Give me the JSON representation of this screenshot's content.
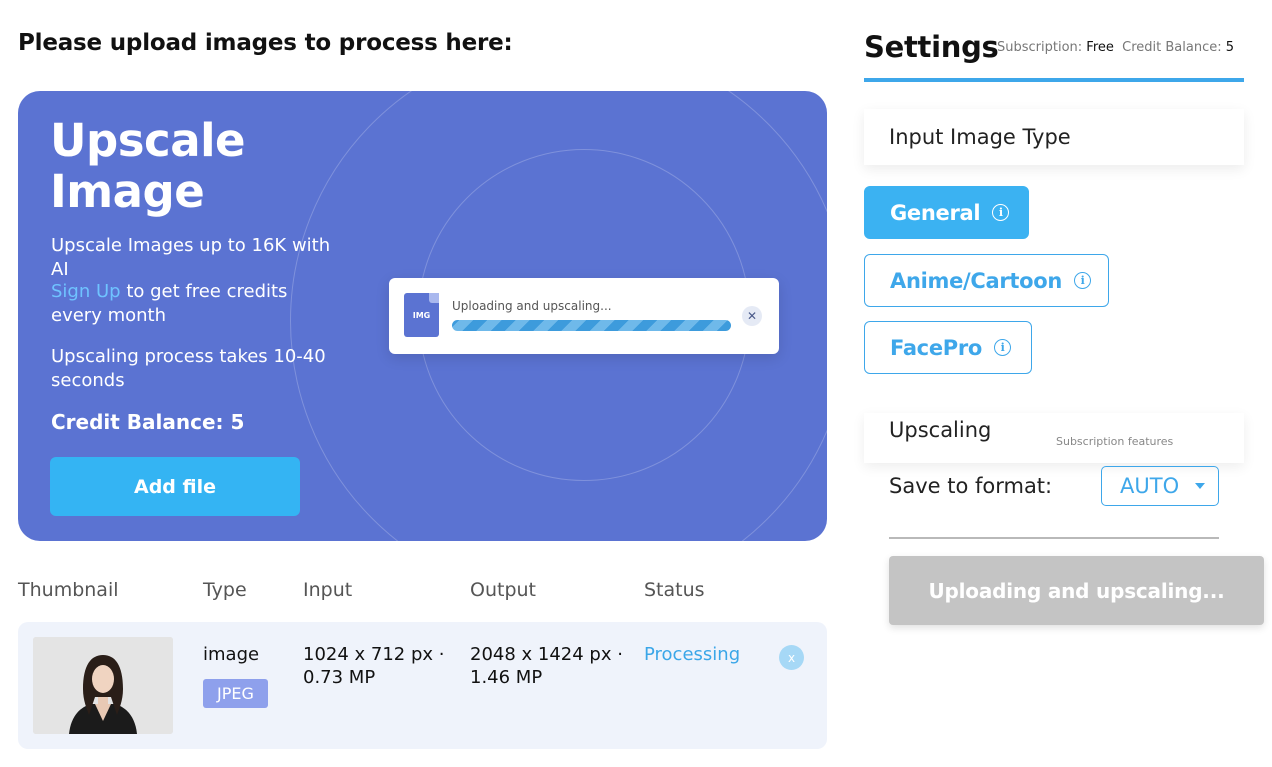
{
  "page": {
    "heading": "Please upload images to process here:"
  },
  "hero": {
    "title": "Upscale Image",
    "line1": "Upscale Images up to 16K with AI",
    "signup_link": "Sign Up",
    "signup_rest": " to get free credits every month",
    "line3": "Upscaling process takes 10-40 seconds",
    "credit_balance": "Credit Balance: 5",
    "add_file": "Add file",
    "upload_card": {
      "file_icon_label": "IMG",
      "status": "Uploading and upscaling...",
      "close": "✕"
    }
  },
  "table": {
    "headers": [
      "Thumbnail",
      "Type",
      "Input",
      "Output",
      "Status"
    ],
    "rows": [
      {
        "type": "image",
        "format": "JPEG",
        "input": "1024 x 712 px · 0.73 MP",
        "output": "2048 x 1424 px · 1.46 MP",
        "status": "Processing",
        "remove": "x"
      }
    ]
  },
  "settings": {
    "title": "Settings",
    "subscription_label": "Subscription:",
    "subscription_value": "Free",
    "credit_label": "Credit Balance:",
    "credit_value": "5",
    "input_type_title": "Input Image Type",
    "types": [
      {
        "label": "General",
        "active": true
      },
      {
        "label": "Anime/Cartoon",
        "active": false
      },
      {
        "label": "FacePro",
        "active": false
      }
    ],
    "upscaling_label": "Upscaling",
    "subscription_features": "Subscription features",
    "save_format_label": "Save to format:",
    "format_value": "AUTO",
    "process_button": "Uploading and upscaling..."
  },
  "colors": {
    "hero_bg": "#5b73d2",
    "accent": "#3ea7ea",
    "add_button": "#34b4f3",
    "badge": "#8ea0ec",
    "disabled_button": "#c4c4c4"
  },
  "icons": {
    "info": "info-icon",
    "close": "close-icon",
    "file": "file-image-icon",
    "caret": "caret-down-icon"
  }
}
